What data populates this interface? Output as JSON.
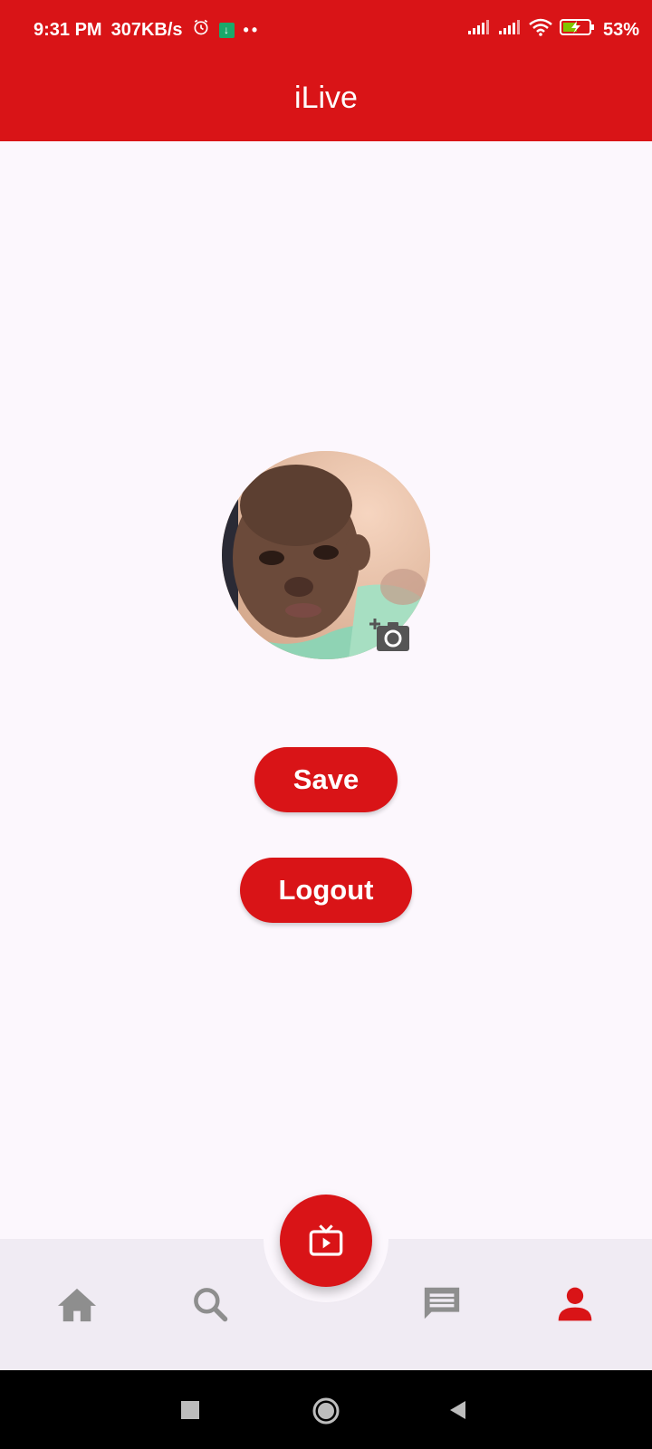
{
  "status_bar": {
    "time": "9:31 PM",
    "net_speed": "307KB/s",
    "battery": "53%",
    "icons": [
      "alarm-icon",
      "download-icon",
      "signal-icon",
      "signal-icon",
      "wifi-icon",
      "battery-charging-icon"
    ]
  },
  "app_bar": {
    "title": "iLive"
  },
  "profile": {
    "avatar_alt": "profile photo",
    "camera_icon": "add-photo-icon"
  },
  "actions": {
    "save_label": "Save",
    "logout_label": "Logout"
  },
  "bottom_nav": {
    "items": [
      {
        "icon": "home-icon",
        "active": false
      },
      {
        "icon": "search-icon",
        "active": false
      },
      {
        "icon": "live-tv-icon",
        "active": true
      },
      {
        "icon": "chat-icon",
        "active": false
      },
      {
        "icon": "person-icon",
        "active": true
      }
    ]
  },
  "colors": {
    "primary": "#d91417",
    "background": "#fcf7fd",
    "nav_background": "#f0ebf3",
    "inactive_icon": "#8e8e8e"
  }
}
